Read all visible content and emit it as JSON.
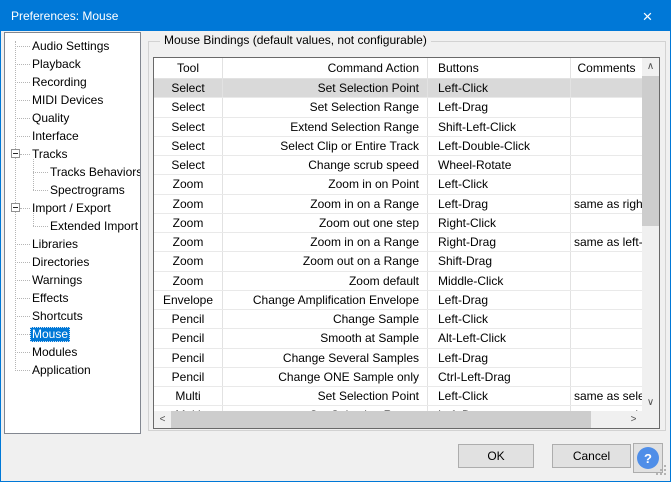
{
  "window": {
    "title": "Preferences: Mouse",
    "close_icon": "×"
  },
  "sidebar": {
    "items": [
      {
        "label": "Audio Settings",
        "depth": 0
      },
      {
        "label": "Playback",
        "depth": 0
      },
      {
        "label": "Recording",
        "depth": 0
      },
      {
        "label": "MIDI Devices",
        "depth": 0
      },
      {
        "label": "Quality",
        "depth": 0
      },
      {
        "label": "Interface",
        "depth": 0
      },
      {
        "label": "Tracks",
        "depth": 0,
        "expanded": true
      },
      {
        "label": "Tracks Behaviors",
        "depth": 1
      },
      {
        "label": "Spectrograms",
        "depth": 1
      },
      {
        "label": "Import / Export",
        "depth": 0,
        "expanded": true
      },
      {
        "label": "Extended Import",
        "depth": 1
      },
      {
        "label": "Libraries",
        "depth": 0
      },
      {
        "label": "Directories",
        "depth": 0
      },
      {
        "label": "Warnings",
        "depth": 0
      },
      {
        "label": "Effects",
        "depth": 0
      },
      {
        "label": "Shortcuts",
        "depth": 0
      },
      {
        "label": "Mouse",
        "depth": 0,
        "selected": true
      },
      {
        "label": "Modules",
        "depth": 0
      },
      {
        "label": "Application",
        "depth": 0
      }
    ]
  },
  "main": {
    "group_title": "Mouse Bindings (default values, not configurable)",
    "table": {
      "columns": [
        "Tool",
        "Command Action",
        "Buttons",
        "Comments"
      ],
      "selected_row": 0,
      "rows": [
        {
          "tool": "Select",
          "action": "Set Selection Point",
          "buttons": "Left-Click",
          "comment": ""
        },
        {
          "tool": "Select",
          "action": "Set Selection Range",
          "buttons": "Left-Drag",
          "comment": ""
        },
        {
          "tool": "Select",
          "action": "Extend Selection Range",
          "buttons": "Shift-Left-Click",
          "comment": ""
        },
        {
          "tool": "Select",
          "action": "Select Clip or Entire Track",
          "buttons": "Left-Double-Click",
          "comment": ""
        },
        {
          "tool": "Select",
          "action": "Change scrub speed",
          "buttons": "Wheel-Rotate",
          "comment": ""
        },
        {
          "tool": "Zoom",
          "action": "Zoom in on Point",
          "buttons": "Left-Click",
          "comment": ""
        },
        {
          "tool": "Zoom",
          "action": "Zoom in on a Range",
          "buttons": "Left-Drag",
          "comment": "same as right"
        },
        {
          "tool": "Zoom",
          "action": "Zoom out one step",
          "buttons": "Right-Click",
          "comment": ""
        },
        {
          "tool": "Zoom",
          "action": "Zoom in on a Range",
          "buttons": "Right-Drag",
          "comment": "same as left-"
        },
        {
          "tool": "Zoom",
          "action": "Zoom out on a Range",
          "buttons": "Shift-Drag",
          "comment": ""
        },
        {
          "tool": "Zoom",
          "action": "Zoom default",
          "buttons": "Middle-Click",
          "comment": ""
        },
        {
          "tool": "Envelope",
          "action": "Change Amplification Envelope",
          "buttons": "Left-Drag",
          "comment": ""
        },
        {
          "tool": "Pencil",
          "action": "Change Sample",
          "buttons": "Left-Click",
          "comment": ""
        },
        {
          "tool": "Pencil",
          "action": "Smooth at Sample",
          "buttons": "Alt-Left-Click",
          "comment": ""
        },
        {
          "tool": "Pencil",
          "action": "Change Several Samples",
          "buttons": "Left-Drag",
          "comment": ""
        },
        {
          "tool": "Pencil",
          "action": "Change ONE Sample only",
          "buttons": "Ctrl-Left-Drag",
          "comment": ""
        },
        {
          "tool": "Multi",
          "action": "Set Selection Point",
          "buttons": "Left-Click",
          "comment": "same as selec"
        },
        {
          "tool": "Multi",
          "action": "Set Selection Range",
          "buttons": "Left-Drag",
          "comment": "same as selec"
        }
      ]
    }
  },
  "icons": {
    "scroll_up": "∧",
    "scroll_down": "∨",
    "scroll_left": "<",
    "scroll_right": ">"
  },
  "footer": {
    "ok_label": "OK",
    "cancel_label": "Cancel",
    "help_label": "?"
  },
  "colors": {
    "accent": "#0078d7",
    "selected_row": "#d9d9d9",
    "help_circle": "#4f8ee8"
  }
}
